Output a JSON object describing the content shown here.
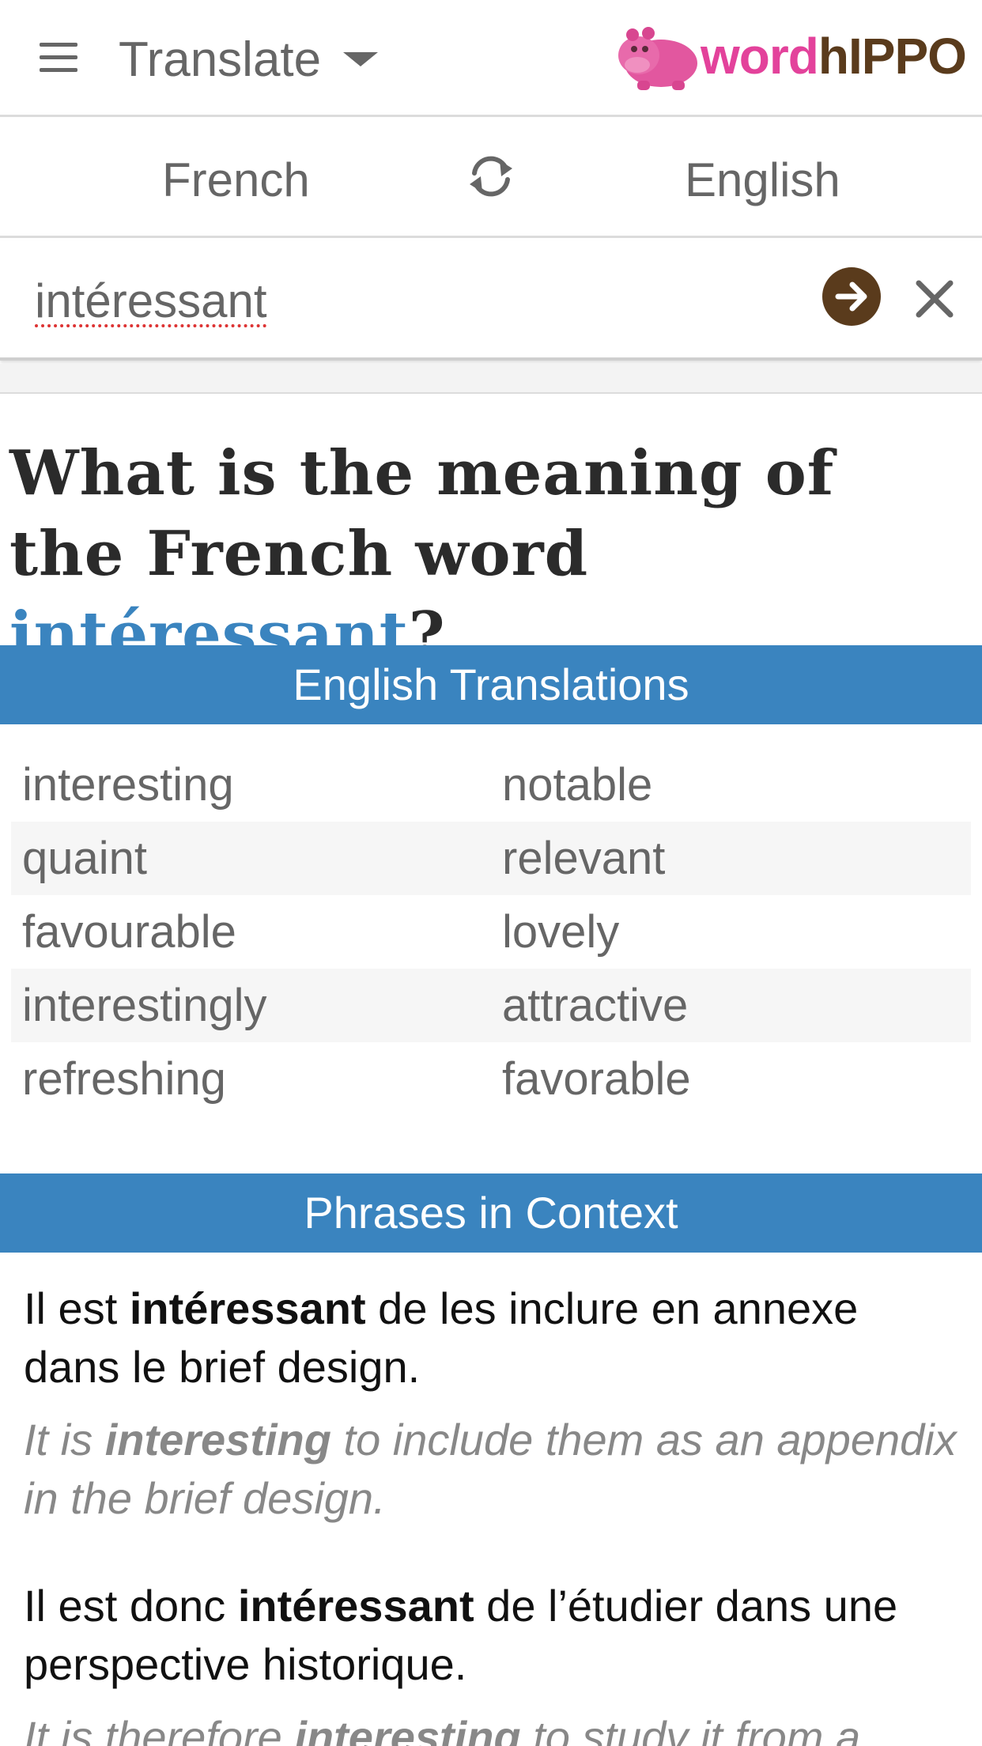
{
  "header": {
    "menu_label": "Translate",
    "logo": {
      "word": "word",
      "hippo": "hIPPO"
    }
  },
  "languages": {
    "source": "French",
    "target": "English"
  },
  "search": {
    "value": "intéressant"
  },
  "question": {
    "prefix": "What is the meaning of the French word ",
    "word": "intéressant",
    "suffix": "?"
  },
  "translations": {
    "title": "English Translations",
    "rows": [
      [
        "interesting",
        "notable"
      ],
      [
        "quaint",
        "relevant"
      ],
      [
        "favourable",
        "lovely"
      ],
      [
        "interestingly",
        "attractive"
      ],
      [
        "refreshing",
        "favorable"
      ]
    ]
  },
  "phrases": {
    "title": "Phrases in Context",
    "items": [
      {
        "fr_before": "Il est ",
        "fr_bold": "intéressant",
        "fr_after": " de les inclure en annexe dans le brief design.",
        "en_before": "It is ",
        "en_bold": "interesting",
        "en_after": " to include them as an appendix in the brief design."
      },
      {
        "fr_before": "Il est donc ",
        "fr_bold": "intéressant",
        "fr_after": " de l’étudier dans une perspective historique.",
        "en_before": "It is therefore ",
        "en_bold": "interesting",
        "en_after": " to study it from a"
      }
    ]
  },
  "colors": {
    "accent_blue": "#3a84bf",
    "brand_brown": "#5a3b1c",
    "brand_pink": "#e3429b"
  }
}
